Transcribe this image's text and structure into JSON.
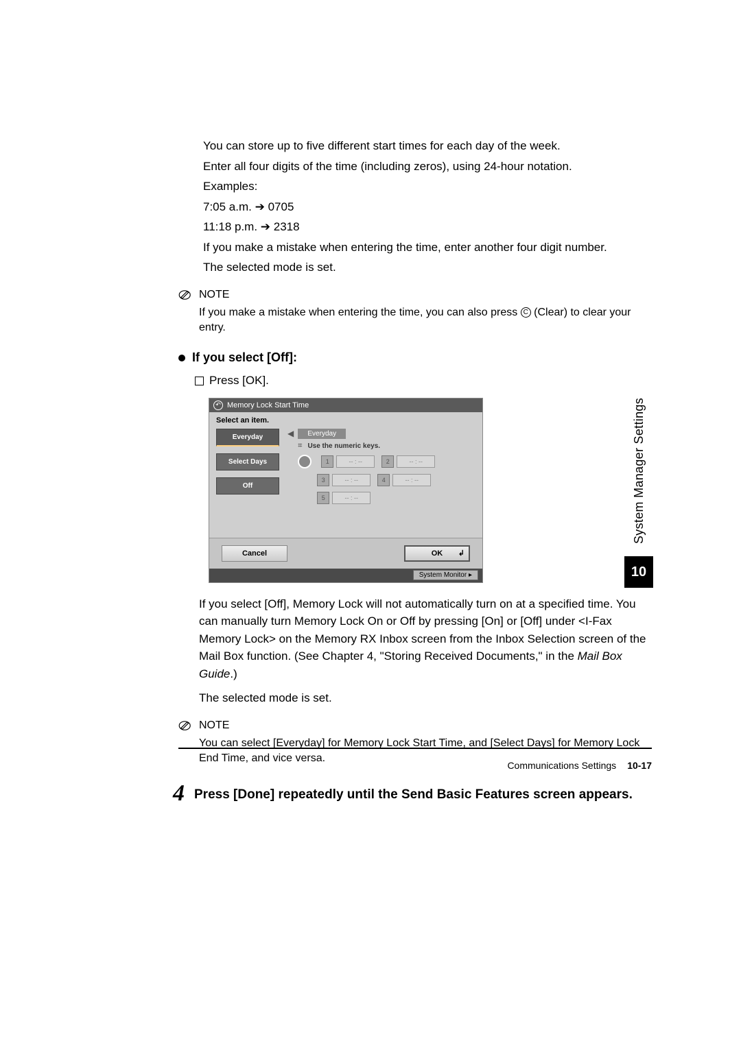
{
  "intro": {
    "p1": "You can store up to five different start times for each day of the week.",
    "p2": "Enter all four digits of the time (including zeros), using 24-hour notation.",
    "p3": "Examples:",
    "ex1a": "7:05 a.m. ",
    "ex1b": " 0705",
    "ex2a": "11:18 p.m. ",
    "ex2b": " 2318",
    "p4": "If you make a mistake when entering the time, enter another four digit number.",
    "p5": "The selected mode is set."
  },
  "note1": {
    "label": "NOTE",
    "text_a": "If you make a mistake when entering the time, you can also press ",
    "clear_glyph": "C",
    "text_b": " (Clear) to clear your entry."
  },
  "off": {
    "heading": "If you select [Off]:",
    "press_ok": "Press [OK]."
  },
  "screenshot": {
    "title": "Memory Lock Start Time",
    "select_item": "Select an item.",
    "tabs": {
      "everyday": "Everyday",
      "select_days": "Select Days",
      "off": "Off"
    },
    "day_label": "Everyday",
    "num_hint": "Use the numeric keys.",
    "placeholder": "-- : --",
    "cancel": "Cancel",
    "ok": "OK",
    "system_monitor": "System Monitor"
  },
  "after": {
    "p1a": "If you select [Off], Memory Lock will not automatically turn on at a specified time. You can manually turn Memory Lock On or Off by pressing [On] or [Off] under <I-Fax Memory Lock> on the Memory RX Inbox screen from the Inbox Selection screen of the Mail Box function. (See Chapter 4, \"Storing Received Documents,\" in the ",
    "p1_em": "Mail Box Guide",
    "p1b": ".)",
    "p2": "The selected mode is set."
  },
  "note2": {
    "label": "NOTE",
    "text": "You can select [Everyday] for Memory Lock Start Time, and [Select Days] for Memory Lock End Time, and vice versa."
  },
  "step4": {
    "num": "4",
    "text": "Press [Done] repeatedly until the Send Basic Features screen appears."
  },
  "side": {
    "vtext": "System Manager Settings",
    "chapter": "10"
  },
  "footer": {
    "section": "Communications Settings",
    "page": "10-17"
  }
}
